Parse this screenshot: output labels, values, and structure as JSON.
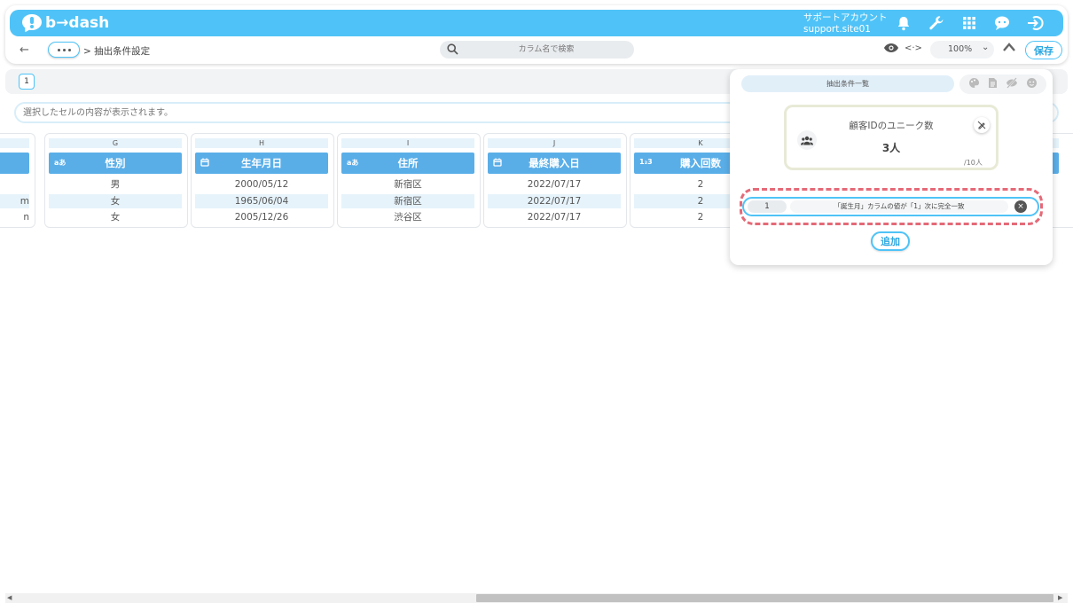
{
  "app": {
    "brand": "b→dash",
    "account_line1": "サポートアカウント",
    "account_line2": "support.site01"
  },
  "toolbar": {
    "back": "←",
    "breadcrumb": "> 抽出条件設定",
    "search_placeholder": "カラム名で検索",
    "zoom_value": "100%",
    "zoom_chevron": "⌄",
    "code_glyph": "<·>",
    "save_label": "保存"
  },
  "sheet": {
    "tab_label": "1",
    "cell_placeholder": "選択したセルの内容が表示されます。"
  },
  "columns": [
    {
      "letter": "",
      "type": "",
      "header": "",
      "cells": [
        "",
        "m",
        "n"
      ]
    },
    {
      "letter": "G",
      "type": "aあ",
      "header": "性別",
      "cells": [
        "男",
        "女",
        "女"
      ]
    },
    {
      "letter": "H",
      "type": "cal",
      "header": "生年月日",
      "cells": [
        "2000/05/12",
        "1965/06/04",
        "2005/12/26"
      ]
    },
    {
      "letter": "I",
      "type": "aあ",
      "header": "住所",
      "cells": [
        "新宿区",
        "新宿区",
        "渋谷区"
      ]
    },
    {
      "letter": "J",
      "type": "cal",
      "header": "最終購入日",
      "cells": [
        "2022/07/17",
        "2022/07/17",
        "2022/07/17"
      ]
    },
    {
      "letter": "K",
      "type": "1₂3",
      "header": "購入回数",
      "cells": [
        "2",
        "2",
        "2"
      ]
    }
  ],
  "panel": {
    "tab_label": "抽出条件一覧",
    "stat_title": "顧客IDのユニーク数",
    "stat_value": "3人",
    "stat_total": "/10人",
    "condition_number": "1",
    "condition_text": "「誕生月」カラムの値が「1」次に完全一致",
    "add_label": "追加"
  },
  "colors": {
    "accent": "#4fc3f7",
    "header_blue": "#5aaee8",
    "highlight": "#e46a78"
  }
}
